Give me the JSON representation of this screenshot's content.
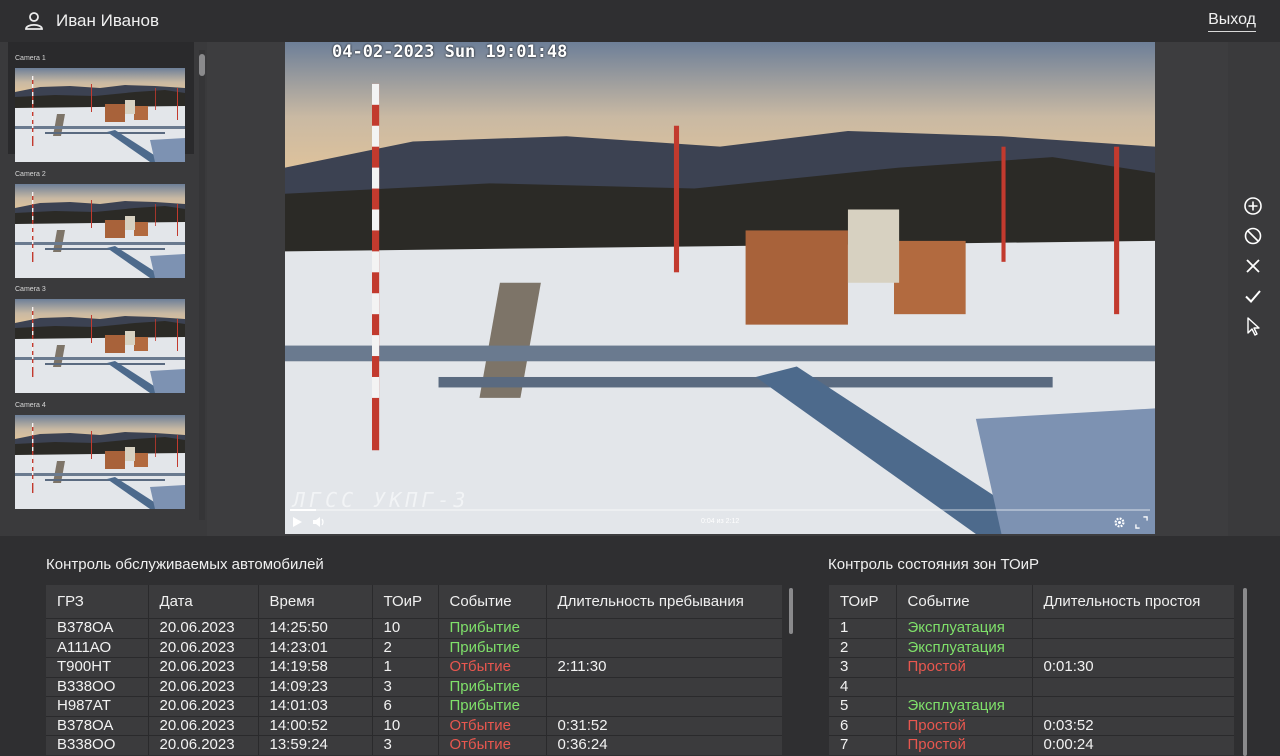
{
  "header": {
    "user_name": "Иван Иванов",
    "logout_label": "Выход"
  },
  "cameras": [
    {
      "label": "Camera 1",
      "active": true
    },
    {
      "label": "Camera 2",
      "active": false
    },
    {
      "label": "Camera 3",
      "active": false
    },
    {
      "label": "Camera 4",
      "active": false
    }
  ],
  "video": {
    "timestamp": "04-02-2023 Sun 19:01:48",
    "overlay_title": "ЛГСС УКПГ-3",
    "time_display": "0:04 из 2:12",
    "progress_fraction": 0.03
  },
  "toolbar": {
    "icons": [
      "add-circle-icon",
      "disable-icon",
      "close-icon",
      "check-icon",
      "cursor-icon"
    ]
  },
  "vehicles": {
    "title": "Контроль обслуживаемых автомобилей",
    "columns": [
      "ГРЗ",
      "Дата",
      "Время",
      "ТОиР",
      "Событие",
      "Длительность пребывания"
    ],
    "rows": [
      {
        "plate": "В378ОА",
        "date": "20.06.2023",
        "time": "14:25:50",
        "zone": "10",
        "event": "Прибытие",
        "duration": ""
      },
      {
        "plate": "А111АО",
        "date": "20.06.2023",
        "time": "14:23:01",
        "zone": "2",
        "event": "Прибытие",
        "duration": ""
      },
      {
        "plate": "Т900НТ",
        "date": "20.06.2023",
        "time": "14:19:58",
        "zone": "1",
        "event": "Отбытие",
        "duration": "2:11:30"
      },
      {
        "plate": "В338ОО",
        "date": "20.06.2023",
        "time": "14:09:23",
        "zone": "3",
        "event": "Прибытие",
        "duration": ""
      },
      {
        "plate": "Н987АТ",
        "date": "20.06.2023",
        "time": "14:01:03",
        "zone": "6",
        "event": "Прибытие",
        "duration": ""
      },
      {
        "plate": "В378ОА",
        "date": "20.06.2023",
        "time": "14:00:52",
        "zone": "10",
        "event": "Отбытие",
        "duration": "0:31:52"
      },
      {
        "plate": "В338ОО",
        "date": "20.06.2023",
        "time": "13:59:24",
        "zone": "3",
        "event": "Отбытие",
        "duration": "0:36:24"
      }
    ]
  },
  "zones": {
    "title": "Контроль состояния зон ТОиР",
    "columns": [
      "ТОиР",
      "Событие",
      "Длительность простоя"
    ],
    "rows": [
      {
        "zone": "1",
        "event": "Эксплуатация",
        "duration": ""
      },
      {
        "zone": "2",
        "event": "Эксплуатация",
        "duration": ""
      },
      {
        "zone": "3",
        "event": "Простой",
        "duration": "0:01:30"
      },
      {
        "zone": "4",
        "event": "",
        "duration": ""
      },
      {
        "zone": "5",
        "event": "Эксплуатация",
        "duration": ""
      },
      {
        "zone": "6",
        "event": "Простой",
        "duration": "0:03:52"
      },
      {
        "zone": "7",
        "event": "Простой",
        "duration": "0:00:24"
      }
    ]
  },
  "colors": {
    "event_green": "#7fe06a",
    "event_red": "#e8574f",
    "background": "#2f2f31"
  }
}
